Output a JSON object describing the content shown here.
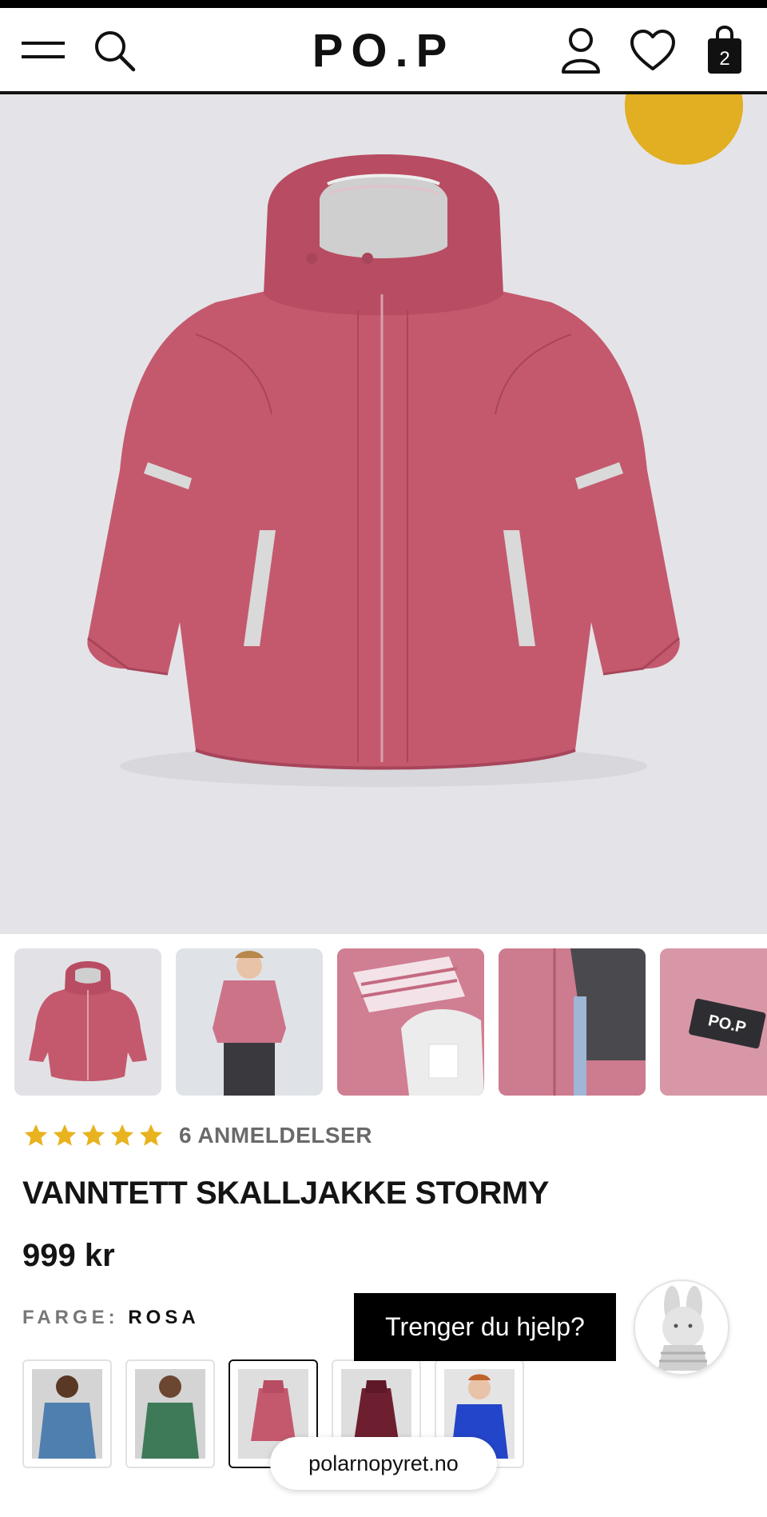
{
  "header": {
    "logo": "PO.P",
    "cart_count": "2",
    "icons": [
      "menu-icon",
      "search-icon",
      "account-icon",
      "heart-icon",
      "cart-icon"
    ]
  },
  "gallery": {
    "thumbnails": [
      "jacket-front",
      "child-wearing-jacket",
      "collar-detail",
      "zipper-detail",
      "logo-patch-detail"
    ]
  },
  "rating": {
    "stars": 5,
    "text": "6 ANMELDELSER"
  },
  "product": {
    "title": "VANNTETT SKALLJAKKE STORMY",
    "price": "999 kr",
    "color_label": "FARGE:",
    "color_value": "ROSA"
  },
  "swatches": [
    {
      "name": "blue",
      "color": "#4f7fae"
    },
    {
      "name": "green",
      "color": "#3e7a58"
    },
    {
      "name": "pink",
      "color": "#c4596e",
      "selected": true
    },
    {
      "name": "burgundy",
      "color": "#6e1f2f"
    },
    {
      "name": "bright-blue",
      "color": "#2345c9"
    }
  ],
  "help": {
    "label": "Trenger du hjelp?"
  },
  "browser": {
    "url": "polarnopyret.no"
  },
  "colors": {
    "jacket": "#c4596e",
    "jacket_shadow": "#a8455b",
    "star": "#e8b31f",
    "badge": "#e2ae22"
  }
}
